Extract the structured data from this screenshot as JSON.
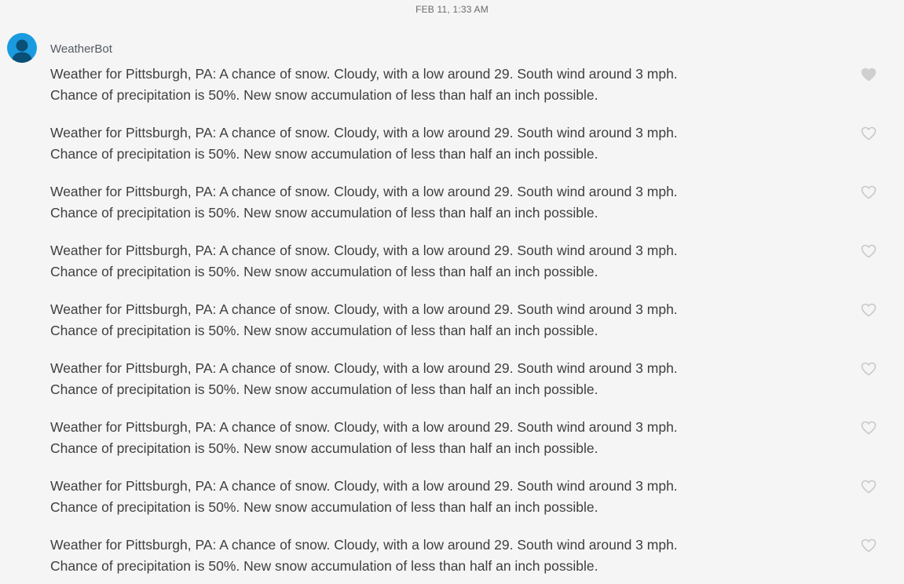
{
  "timestamp": "FEB 11, 1:33 AM",
  "sender": {
    "name": "WeatherBot",
    "avatar_color": "#1a9be0",
    "avatar_icon": "person-silhouette-icon"
  },
  "heart_colors": {
    "filled": "#cfcfcf",
    "outline": "#c8c8c8"
  },
  "messages": [
    {
      "text": "Weather for Pittsburgh, PA: A chance of snow. Cloudy, with a low around 29. South wind around 3 mph. Chance of precipitation is 50%. New snow accumulation of less than half an inch possible.",
      "heart": "filled"
    },
    {
      "text": "Weather for Pittsburgh, PA: A chance of snow. Cloudy, with a low around 29. South wind around 3 mph. Chance of precipitation is 50%. New snow accumulation of less than half an inch possible.",
      "heart": "outline"
    },
    {
      "text": "Weather for Pittsburgh, PA: A chance of snow. Cloudy, with a low around 29. South wind around 3 mph. Chance of precipitation is 50%. New snow accumulation of less than half an inch possible.",
      "heart": "outline"
    },
    {
      "text": "Weather for Pittsburgh, PA: A chance of snow. Cloudy, with a low around 29. South wind around 3 mph. Chance of precipitation is 50%. New snow accumulation of less than half an inch possible.",
      "heart": "outline"
    },
    {
      "text": "Weather for Pittsburgh, PA: A chance of snow. Cloudy, with a low around 29. South wind around 3 mph. Chance of precipitation is 50%. New snow accumulation of less than half an inch possible.",
      "heart": "outline"
    },
    {
      "text": "Weather for Pittsburgh, PA: A chance of snow. Cloudy, with a low around 29. South wind around 3 mph. Chance of precipitation is 50%. New snow accumulation of less than half an inch possible.",
      "heart": "outline"
    },
    {
      "text": "Weather for Pittsburgh, PA: A chance of snow. Cloudy, with a low around 29. South wind around 3 mph. Chance of precipitation is 50%. New snow accumulation of less than half an inch possible.",
      "heart": "outline"
    },
    {
      "text": "Weather for Pittsburgh, PA: A chance of snow. Cloudy, with a low around 29. South wind around 3 mph. Chance of precipitation is 50%. New snow accumulation of less than half an inch possible.",
      "heart": "outline"
    },
    {
      "text": "Weather for Pittsburgh, PA: A chance of snow. Cloudy, with a low around 29. South wind around 3 mph. Chance of precipitation is 50%. New snow accumulation of less than half an inch possible.",
      "heart": "outline"
    }
  ]
}
